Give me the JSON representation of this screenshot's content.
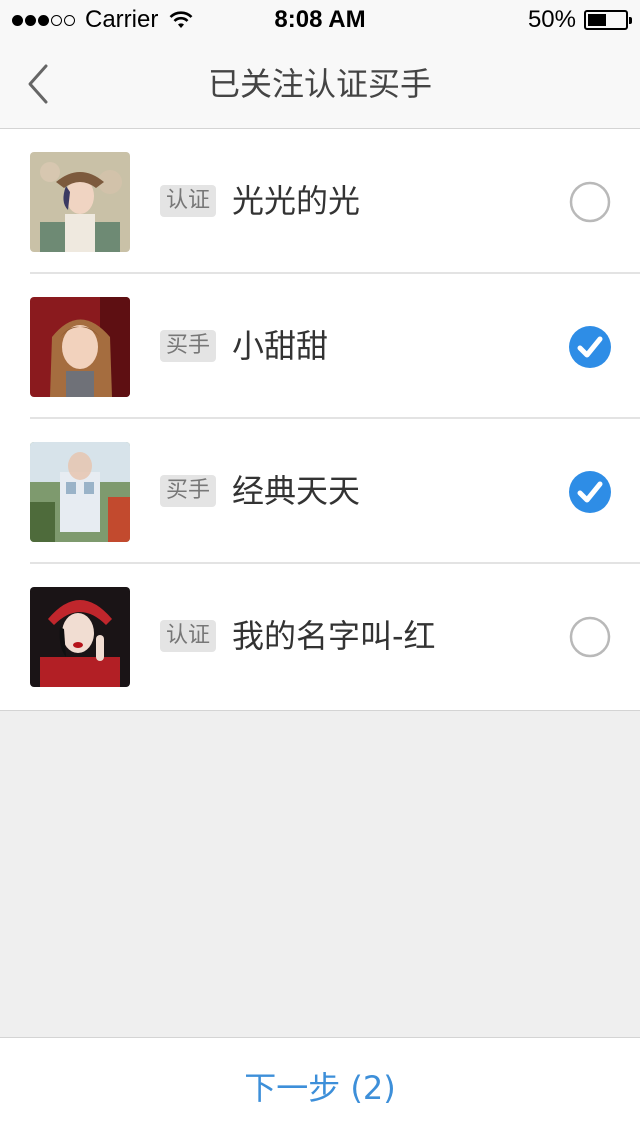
{
  "status": {
    "carrier": "Carrier",
    "time": "8:08 AM",
    "battery": "50%",
    "battery_level": 0.5
  },
  "nav": {
    "title": "已关注认证买手"
  },
  "items": [
    {
      "tag": "认证",
      "name": "光光的光",
      "checked": false
    },
    {
      "tag": "买手",
      "name": "小甜甜",
      "checked": true
    },
    {
      "tag": "买手",
      "name": "经典天天",
      "checked": true
    },
    {
      "tag": "认证",
      "name": "我的名字叫-红",
      "checked": false
    }
  ],
  "footer": {
    "next_label": "下一步 (2)"
  },
  "colors": {
    "accent": "#3d8fd9",
    "check": "#2e8de6"
  }
}
